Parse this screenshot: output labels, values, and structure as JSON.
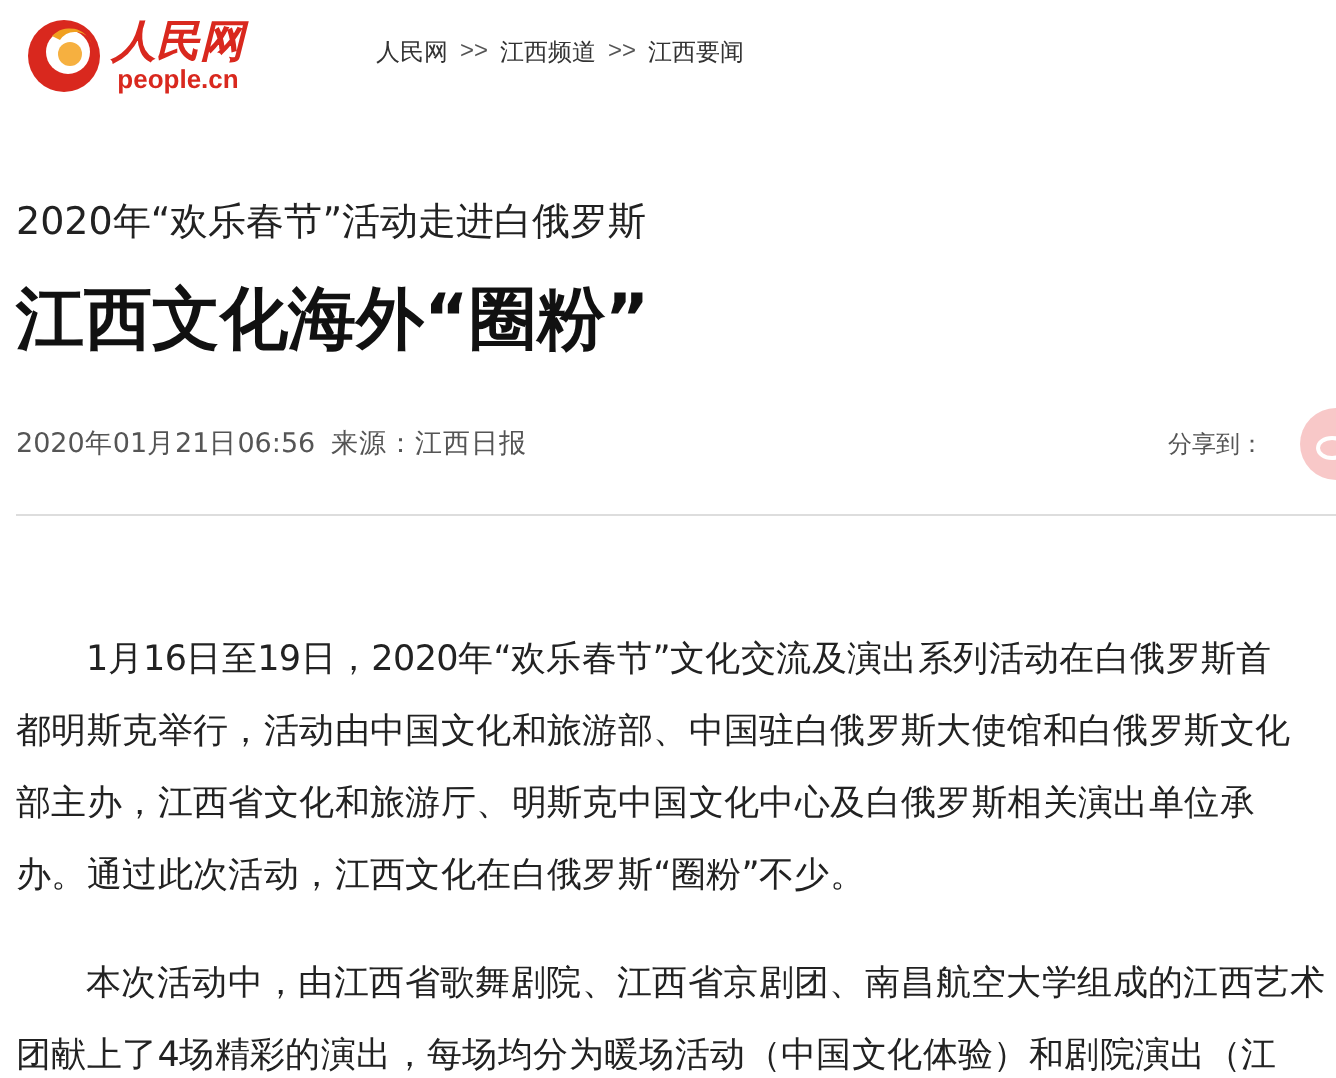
{
  "logo": {
    "name": "人民网",
    "domain": "people.cn"
  },
  "breadcrumb": [
    {
      "label": "人民网"
    },
    {
      "label": "江西频道"
    },
    {
      "label": "江西要闻"
    }
  ],
  "breadcrumb_separator": ">>",
  "article": {
    "kicker": "2020年“欢乐春节”活动走进白俄罗斯",
    "title": "江西文化海外“圈粉”",
    "date": "2020年01月21日06:56",
    "source": "来源：江西日报",
    "share_label": "分享到：",
    "paragraphs": [
      "1月16日至19日，2020年“欢乐春节”文化交流及演出系列活动在白俄罗斯首都明斯克举行，活动由中国文化和旅游部、中国驻白俄罗斯大使馆和白俄罗斯文化部主办，江西省文化和旅游厅、明斯克中国文化中心及白俄罗斯相关演出单位承办。通过此次活动，江西文化在白俄罗斯“圈粉”不少。",
      "本次活动中，由江西省歌舞剧院、江西省京剧团、南昌航空大学组成的江西艺术团献上了4场精彩的演出，每场均分为暖场活动（中国文化体验）和剧院演出（江"
    ]
  }
}
